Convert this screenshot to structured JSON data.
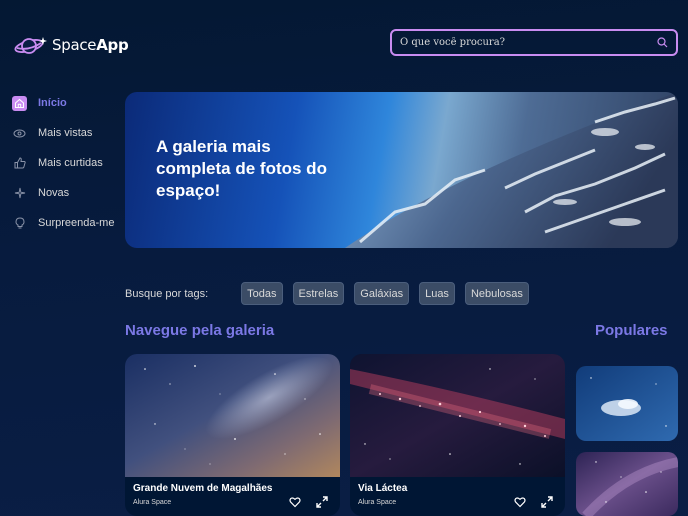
{
  "header": {
    "logo_prefix": "Space",
    "logo_suffix": "App",
    "search_placeholder": "O que você procura?"
  },
  "sidebar": {
    "items": [
      {
        "label": "Início",
        "icon": "home-icon",
        "active": true
      },
      {
        "label": "Mais vistas",
        "icon": "eye-icon"
      },
      {
        "label": "Mais curtidas",
        "icon": "thumbs-up-icon"
      },
      {
        "label": "Novas",
        "icon": "sparkle-icon"
      },
      {
        "label": "Surpreenda-me",
        "icon": "lightbulb-icon"
      }
    ]
  },
  "hero": {
    "title": "A galeria mais completa de fotos do espaço!"
  },
  "tags": {
    "label": "Busque por tags:",
    "items": [
      "Todas",
      "Estrelas",
      "Galáxias",
      "Luas",
      "Nebulosas"
    ]
  },
  "gallery": {
    "title": "Navegue pela galeria",
    "cards": [
      {
        "title": "Grande Nuvem de Magalhães",
        "author": "Alura Space"
      },
      {
        "title": "Via Láctea",
        "author": "Alura Space"
      }
    ]
  },
  "popular": {
    "title": "Populares"
  },
  "colors": {
    "accent": "#7b78e5",
    "search_border": "#c98cf1",
    "background": "#041833"
  }
}
